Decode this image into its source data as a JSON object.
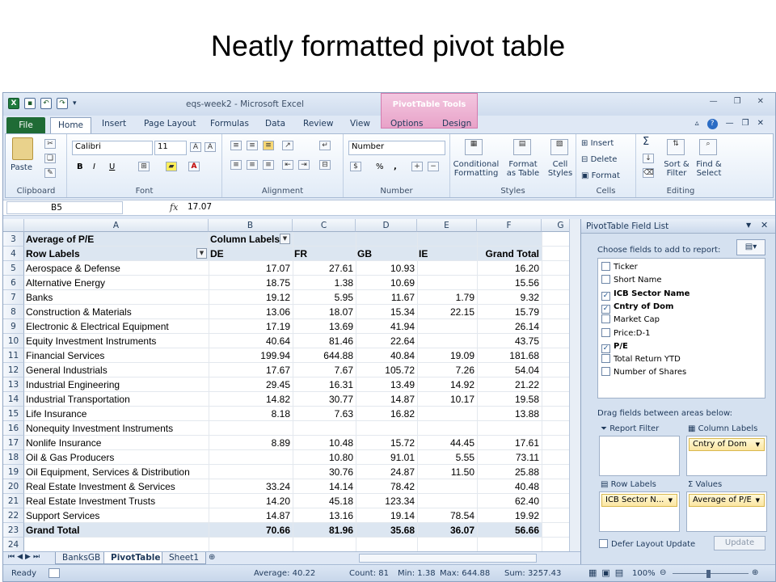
{
  "slide_title": "Neatly formatted pivot table",
  "window": {
    "title": "eqs-week2 - Microsoft Excel",
    "contextual_tab_group": "PivotTable Tools"
  },
  "tabs": [
    "File",
    "Home",
    "Insert",
    "Page Layout",
    "Formulas",
    "Data",
    "Review",
    "View",
    "Options",
    "Design"
  ],
  "ribbon": {
    "clipboard": {
      "label": "Clipboard",
      "paste": "Paste"
    },
    "font": {
      "label": "Font",
      "name": "Calibri",
      "size": "11",
      "bold": "B",
      "italic": "I",
      "underline": "U"
    },
    "alignment": {
      "label": "Alignment"
    },
    "number": {
      "label": "Number",
      "format": "Number",
      "percent": "%",
      "comma": ","
    },
    "styles": {
      "label": "Styles",
      "conditional": [
        "Conditional",
        "Formatting"
      ],
      "format_table": [
        "Format",
        "as Table"
      ],
      "cell_styles": [
        "Cell",
        "Styles"
      ]
    },
    "cells": {
      "label": "Cells",
      "insert": "Insert",
      "delete": "Delete",
      "format": "Format"
    },
    "editing": {
      "label": "Editing",
      "sort": [
        "Sort &",
        "Filter"
      ],
      "find": [
        "Find &",
        "Select"
      ],
      "sigma": "Σ"
    }
  },
  "formula_bar": {
    "name_box": "B5",
    "fx": "fx",
    "value": "17.07"
  },
  "columns": [
    "A",
    "B",
    "C",
    "D",
    "E",
    "F",
    "G"
  ],
  "pivot": {
    "title": "Average of P/E",
    "column_labels": "Column Labels",
    "row_labels": "Row Labels",
    "headers": [
      "DE",
      "FR",
      "GB",
      "IE",
      "Grand Total"
    ],
    "rows": [
      {
        "n": "5",
        "label": "Aerospace & Defense",
        "v": [
          "17.07",
          "27.61",
          "10.93",
          "",
          "16.20"
        ]
      },
      {
        "n": "6",
        "label": "Alternative Energy",
        "v": [
          "18.75",
          "1.38",
          "10.69",
          "",
          "15.56"
        ]
      },
      {
        "n": "7",
        "label": "Banks",
        "v": [
          "19.12",
          "5.95",
          "11.67",
          "1.79",
          "9.32"
        ]
      },
      {
        "n": "8",
        "label": "Construction & Materials",
        "v": [
          "13.06",
          "18.07",
          "15.34",
          "22.15",
          "15.79"
        ]
      },
      {
        "n": "9",
        "label": "Electronic & Electrical Equipment",
        "v": [
          "17.19",
          "13.69",
          "41.94",
          "",
          "26.14"
        ]
      },
      {
        "n": "10",
        "label": "Equity Investment Instruments",
        "v": [
          "40.64",
          "81.46",
          "22.64",
          "",
          "43.75"
        ]
      },
      {
        "n": "11",
        "label": "Financial Services",
        "v": [
          "199.94",
          "644.88",
          "40.84",
          "19.09",
          "181.68"
        ]
      },
      {
        "n": "12",
        "label": "General Industrials",
        "v": [
          "17.67",
          "7.67",
          "105.72",
          "7.26",
          "54.04"
        ]
      },
      {
        "n": "13",
        "label": "Industrial Engineering",
        "v": [
          "29.45",
          "16.31",
          "13.49",
          "14.92",
          "21.22"
        ]
      },
      {
        "n": "14",
        "label": "Industrial Transportation",
        "v": [
          "14.82",
          "30.77",
          "14.87",
          "10.17",
          "19.58"
        ]
      },
      {
        "n": "15",
        "label": "Life Insurance",
        "v": [
          "8.18",
          "7.63",
          "16.82",
          "",
          "13.88"
        ]
      },
      {
        "n": "16",
        "label": "Nonequity Investment Instruments",
        "v": [
          "",
          "",
          "",
          "",
          ""
        ]
      },
      {
        "n": "17",
        "label": "Nonlife Insurance",
        "v": [
          "8.89",
          "10.48",
          "15.72",
          "44.45",
          "17.61"
        ]
      },
      {
        "n": "18",
        "label": "Oil & Gas Producers",
        "v": [
          "",
          "10.80",
          "91.01",
          "5.55",
          "73.11"
        ]
      },
      {
        "n": "19",
        "label": "Oil Equipment, Services & Distribution",
        "v": [
          "",
          "30.76",
          "24.87",
          "11.50",
          "25.88"
        ]
      },
      {
        "n": "20",
        "label": "Real Estate Investment & Services",
        "v": [
          "33.24",
          "14.14",
          "78.42",
          "",
          "40.48"
        ]
      },
      {
        "n": "21",
        "label": "Real Estate Investment Trusts",
        "v": [
          "14.20",
          "45.18",
          "123.34",
          "",
          "62.40"
        ]
      },
      {
        "n": "22",
        "label": "Support Services",
        "v": [
          "14.87",
          "13.16",
          "19.14",
          "78.54",
          "19.92"
        ]
      }
    ],
    "grand_total": {
      "label": "Grand Total",
      "v": [
        "70.66",
        "81.96",
        "35.68",
        "36.07",
        "56.66"
      ]
    }
  },
  "row_numbers_top": [
    "3",
    "4"
  ],
  "row_numbers_bottom": [
    "23",
    "24"
  ],
  "sheets": [
    "BanksGB",
    "PivotTable",
    "Sheet1"
  ],
  "status": {
    "ready": "Ready",
    "average": "Average: 40.22",
    "count": "Count: 81",
    "min": "Min: 1.38",
    "max": "Max: 644.88",
    "sum": "Sum: 3257.43",
    "zoom": "100%"
  },
  "field_list": {
    "title": "PivotTable Field List",
    "choose": "Choose fields to add to report:",
    "fields": [
      {
        "name": "Ticker",
        "checked": false
      },
      {
        "name": "Short Name",
        "checked": false
      },
      {
        "name": "ICB Sector Name",
        "checked": true
      },
      {
        "name": "Cntry of Dom",
        "checked": true
      },
      {
        "name": "Market Cap",
        "checked": false
      },
      {
        "name": "Price:D-1",
        "checked": false
      },
      {
        "name": "P/E",
        "checked": true
      },
      {
        "name": "Total Return YTD",
        "checked": false
      },
      {
        "name": "Number of Shares",
        "checked": false
      }
    ],
    "drag_label": "Drag fields between areas below:",
    "report_filter": "Report Filter",
    "column_labels": "Column Labels",
    "row_labels": "Row Labels",
    "values": "Values",
    "column_chip": "Cntry of Dom",
    "row_chip": "ICB Sector N...",
    "values_chip": "Average of P/E",
    "defer": "Defer Layout Update",
    "update": "Update"
  }
}
